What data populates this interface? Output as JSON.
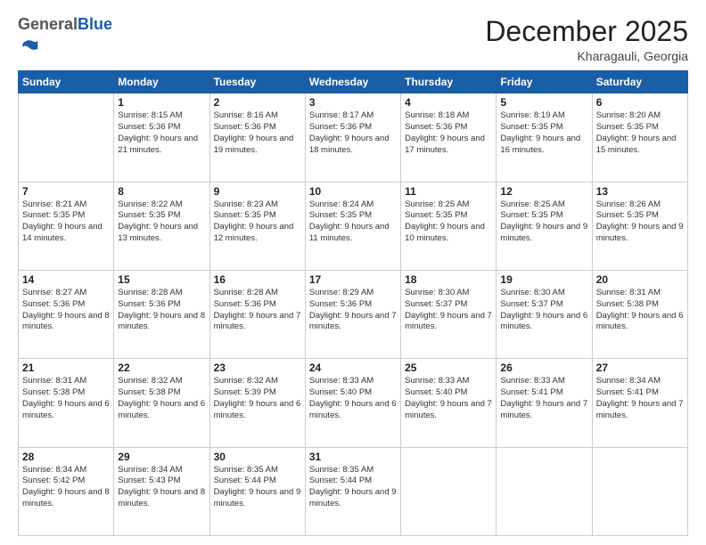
{
  "logo": {
    "general": "General",
    "blue": "Blue"
  },
  "header": {
    "month": "December 2025",
    "location": "Kharagauli, Georgia"
  },
  "weekdays": [
    "Sunday",
    "Monday",
    "Tuesday",
    "Wednesday",
    "Thursday",
    "Friday",
    "Saturday"
  ],
  "weeks": [
    [
      {
        "day": null
      },
      {
        "day": "1",
        "sunrise": "Sunrise: 8:15 AM",
        "sunset": "Sunset: 5:36 PM",
        "daylight": "Daylight: 9 hours and 21 minutes."
      },
      {
        "day": "2",
        "sunrise": "Sunrise: 8:16 AM",
        "sunset": "Sunset: 5:36 PM",
        "daylight": "Daylight: 9 hours and 19 minutes."
      },
      {
        "day": "3",
        "sunrise": "Sunrise: 8:17 AM",
        "sunset": "Sunset: 5:36 PM",
        "daylight": "Daylight: 9 hours and 18 minutes."
      },
      {
        "day": "4",
        "sunrise": "Sunrise: 8:18 AM",
        "sunset": "Sunset: 5:36 PM",
        "daylight": "Daylight: 9 hours and 17 minutes."
      },
      {
        "day": "5",
        "sunrise": "Sunrise: 8:19 AM",
        "sunset": "Sunset: 5:35 PM",
        "daylight": "Daylight: 9 hours and 16 minutes."
      },
      {
        "day": "6",
        "sunrise": "Sunrise: 8:20 AM",
        "sunset": "Sunset: 5:35 PM",
        "daylight": "Daylight: 9 hours and 15 minutes."
      }
    ],
    [
      {
        "day": "7",
        "sunrise": "Sunrise: 8:21 AM",
        "sunset": "Sunset: 5:35 PM",
        "daylight": "Daylight: 9 hours and 14 minutes."
      },
      {
        "day": "8",
        "sunrise": "Sunrise: 8:22 AM",
        "sunset": "Sunset: 5:35 PM",
        "daylight": "Daylight: 9 hours and 13 minutes."
      },
      {
        "day": "9",
        "sunrise": "Sunrise: 8:23 AM",
        "sunset": "Sunset: 5:35 PM",
        "daylight": "Daylight: 9 hours and 12 minutes."
      },
      {
        "day": "10",
        "sunrise": "Sunrise: 8:24 AM",
        "sunset": "Sunset: 5:35 PM",
        "daylight": "Daylight: 9 hours and 11 minutes."
      },
      {
        "day": "11",
        "sunrise": "Sunrise: 8:25 AM",
        "sunset": "Sunset: 5:35 PM",
        "daylight": "Daylight: 9 hours and 10 minutes."
      },
      {
        "day": "12",
        "sunrise": "Sunrise: 8:25 AM",
        "sunset": "Sunset: 5:35 PM",
        "daylight": "Daylight: 9 hours and 9 minutes."
      },
      {
        "day": "13",
        "sunrise": "Sunrise: 8:26 AM",
        "sunset": "Sunset: 5:35 PM",
        "daylight": "Daylight: 9 hours and 9 minutes."
      }
    ],
    [
      {
        "day": "14",
        "sunrise": "Sunrise: 8:27 AM",
        "sunset": "Sunset: 5:36 PM",
        "daylight": "Daylight: 9 hours and 8 minutes."
      },
      {
        "day": "15",
        "sunrise": "Sunrise: 8:28 AM",
        "sunset": "Sunset: 5:36 PM",
        "daylight": "Daylight: 9 hours and 8 minutes."
      },
      {
        "day": "16",
        "sunrise": "Sunrise: 8:28 AM",
        "sunset": "Sunset: 5:36 PM",
        "daylight": "Daylight: 9 hours and 7 minutes."
      },
      {
        "day": "17",
        "sunrise": "Sunrise: 8:29 AM",
        "sunset": "Sunset: 5:36 PM",
        "daylight": "Daylight: 9 hours and 7 minutes."
      },
      {
        "day": "18",
        "sunrise": "Sunrise: 8:30 AM",
        "sunset": "Sunset: 5:37 PM",
        "daylight": "Daylight: 9 hours and 7 minutes."
      },
      {
        "day": "19",
        "sunrise": "Sunrise: 8:30 AM",
        "sunset": "Sunset: 5:37 PM",
        "daylight": "Daylight: 9 hours and 6 minutes."
      },
      {
        "day": "20",
        "sunrise": "Sunrise: 8:31 AM",
        "sunset": "Sunset: 5:38 PM",
        "daylight": "Daylight: 9 hours and 6 minutes."
      }
    ],
    [
      {
        "day": "21",
        "sunrise": "Sunrise: 8:31 AM",
        "sunset": "Sunset: 5:38 PM",
        "daylight": "Daylight: 9 hours and 6 minutes."
      },
      {
        "day": "22",
        "sunrise": "Sunrise: 8:32 AM",
        "sunset": "Sunset: 5:38 PM",
        "daylight": "Daylight: 9 hours and 6 minutes."
      },
      {
        "day": "23",
        "sunrise": "Sunrise: 8:32 AM",
        "sunset": "Sunset: 5:39 PM",
        "daylight": "Daylight: 9 hours and 6 minutes."
      },
      {
        "day": "24",
        "sunrise": "Sunrise: 8:33 AM",
        "sunset": "Sunset: 5:40 PM",
        "daylight": "Daylight: 9 hours and 6 minutes."
      },
      {
        "day": "25",
        "sunrise": "Sunrise: 8:33 AM",
        "sunset": "Sunset: 5:40 PM",
        "daylight": "Daylight: 9 hours and 7 minutes."
      },
      {
        "day": "26",
        "sunrise": "Sunrise: 8:33 AM",
        "sunset": "Sunset: 5:41 PM",
        "daylight": "Daylight: 9 hours and 7 minutes."
      },
      {
        "day": "27",
        "sunrise": "Sunrise: 8:34 AM",
        "sunset": "Sunset: 5:41 PM",
        "daylight": "Daylight: 9 hours and 7 minutes."
      }
    ],
    [
      {
        "day": "28",
        "sunrise": "Sunrise: 8:34 AM",
        "sunset": "Sunset: 5:42 PM",
        "daylight": "Daylight: 9 hours and 8 minutes."
      },
      {
        "day": "29",
        "sunrise": "Sunrise: 8:34 AM",
        "sunset": "Sunset: 5:43 PM",
        "daylight": "Daylight: 9 hours and 8 minutes."
      },
      {
        "day": "30",
        "sunrise": "Sunrise: 8:35 AM",
        "sunset": "Sunset: 5:44 PM",
        "daylight": "Daylight: 9 hours and 9 minutes."
      },
      {
        "day": "31",
        "sunrise": "Sunrise: 8:35 AM",
        "sunset": "Sunset: 5:44 PM",
        "daylight": "Daylight: 9 hours and 9 minutes."
      },
      {
        "day": null
      },
      {
        "day": null
      },
      {
        "day": null
      }
    ]
  ]
}
